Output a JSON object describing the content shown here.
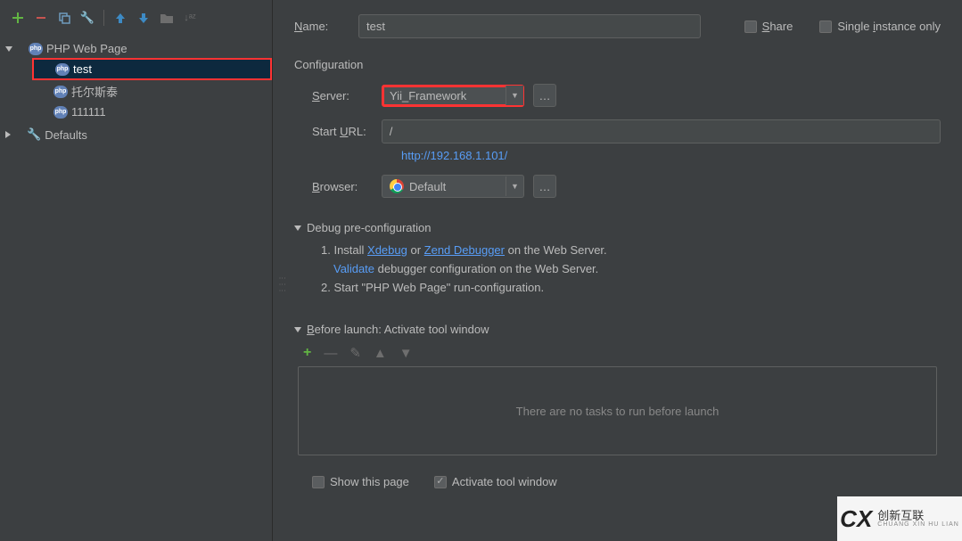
{
  "name_label": "Name:",
  "name_value": "test",
  "share_label": "Share",
  "single_instance_label": "Single instance only",
  "configuration_title": "Configuration",
  "server_label": "Server:",
  "server_value": "Yii_Framework",
  "start_url_label": "Start URL:",
  "start_url_value": "/",
  "resolved_url": "http://192.168.1.101/",
  "browser_label": "Browser:",
  "browser_value": "Default",
  "debug_section_title": "Debug pre-configuration",
  "debug_step1_prefix": "1. Install ",
  "debug_xdebug": "Xdebug",
  "debug_or": " or ",
  "debug_zend": "Zend Debugger",
  "debug_step1_suffix": " on the Web Server.",
  "debug_validate": "Validate",
  "debug_validate_suffix": " debugger configuration on the Web Server.",
  "debug_step2": "2. Start \"PHP Web Page\" run-configuration.",
  "before_launch_title": "Before launch: Activate tool window",
  "no_tasks_text": "There are no tasks to run before launch",
  "show_this_page_label": "Show this page",
  "activate_tool_label": "Activate tool window",
  "tree": {
    "root_label": "PHP Web Page",
    "items": [
      "test",
      "托尔斯泰",
      "111111"
    ],
    "defaults_label": "Defaults"
  },
  "watermark": {
    "brand": "创新互联",
    "sub": "CHUANG XIN HU LIAN"
  }
}
